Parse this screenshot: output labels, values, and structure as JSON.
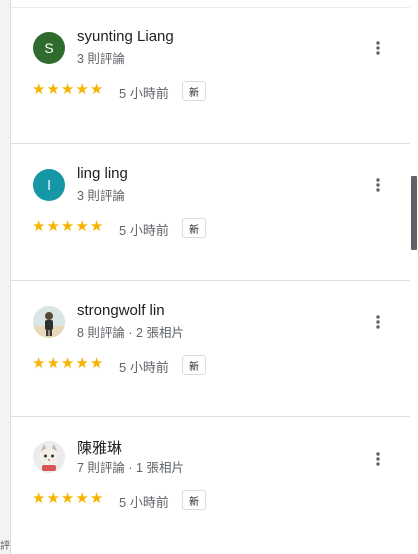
{
  "sidebar_edge_text": "評",
  "reviews": [
    {
      "name": "syunting Liang",
      "meta": "3 則評論",
      "avatar_letter": "S",
      "avatar_color": "#2e6b2d",
      "avatar_type": "letter",
      "rating": 5,
      "time": "5 小時前",
      "badge": "新",
      "more_icon": "more-vert-icon"
    },
    {
      "name": "ling ling",
      "meta": "3 則評論",
      "avatar_letter": "l",
      "avatar_color": "#1597a6",
      "avatar_type": "letter",
      "rating": 5,
      "time": "5 小時前",
      "badge": "新",
      "more_icon": "more-vert-icon"
    },
    {
      "name": "strongwolf lin",
      "meta": "8 則評論 · 2 張相片",
      "avatar_type": "photo-person",
      "rating": 5,
      "time": "5 小時前",
      "badge": "新",
      "more_icon": "more-vert-icon"
    },
    {
      "name": "陳雅琳",
      "meta": "7 則評論 · 1 張相片",
      "avatar_type": "photo-cat",
      "rating": 5,
      "time": "5 小時前",
      "badge": "新",
      "more_icon": "more-vert-icon"
    }
  ],
  "star_color": "#f6b400",
  "scrollbar_position_fraction": 0.32
}
